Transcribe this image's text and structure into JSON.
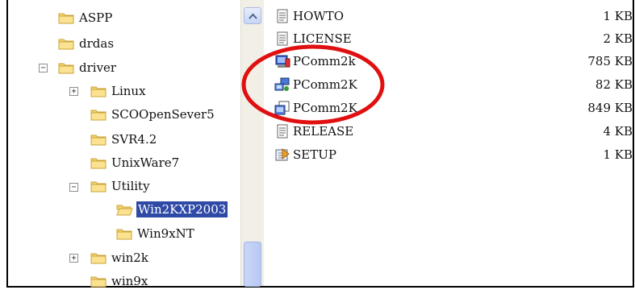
{
  "tree": {
    "items": [
      {
        "label": "ASPP"
      },
      {
        "label": "drdas"
      },
      {
        "label": "driver"
      },
      {
        "label": "Linux"
      },
      {
        "label": "SCOOpenSever5"
      },
      {
        "label": "SVR4.2"
      },
      {
        "label": "UnixWare7"
      },
      {
        "label": "Utility"
      },
      {
        "label": "Win2KXP2003"
      },
      {
        "label": "Win9xNT"
      },
      {
        "label": "win2k"
      },
      {
        "label": "win9x"
      }
    ],
    "selected": "Win2KXP2003"
  },
  "files": [
    {
      "name": "HOWTO",
      "size": "1 KB",
      "icon": "text-file-icon"
    },
    {
      "name": "LICENSE",
      "size": "2 KB",
      "icon": "text-file-icon"
    },
    {
      "name": "PComm2k",
      "size": "785 KB",
      "icon": "application-icon"
    },
    {
      "name": "PComm2K",
      "size": "82 KB",
      "icon": "network-computer-icon"
    },
    {
      "name": "PComm2K",
      "size": "849 KB",
      "icon": "setup-package-icon"
    },
    {
      "name": "RELEASE",
      "size": "4 KB",
      "icon": "text-file-icon"
    },
    {
      "name": "SETUP",
      "size": "1 KB",
      "icon": "setup-icon"
    }
  ],
  "colors": {
    "selection": "#2f4aa6",
    "folder": "#f6d26a",
    "annotation": "#e01010"
  }
}
